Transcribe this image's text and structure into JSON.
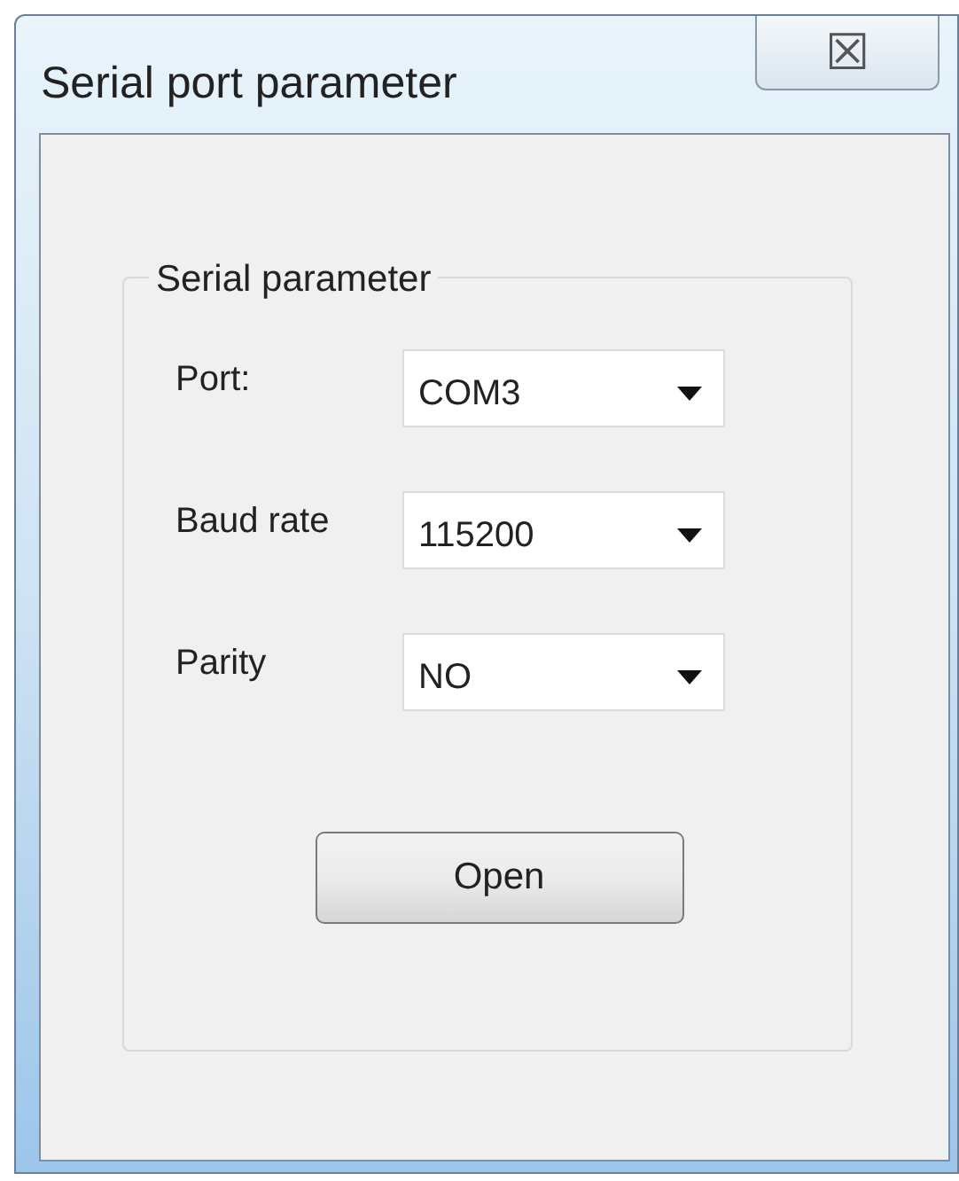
{
  "window": {
    "title": "Serial port parameter",
    "close_icon": "☒"
  },
  "group": {
    "title": "Serial parameter",
    "fields": [
      {
        "label": "Port:",
        "value": "COM3"
      },
      {
        "label": "Baud rate",
        "value": "115200"
      },
      {
        "label": "Parity",
        "value": "NO"
      }
    ]
  },
  "buttons": [
    "Open"
  ]
}
